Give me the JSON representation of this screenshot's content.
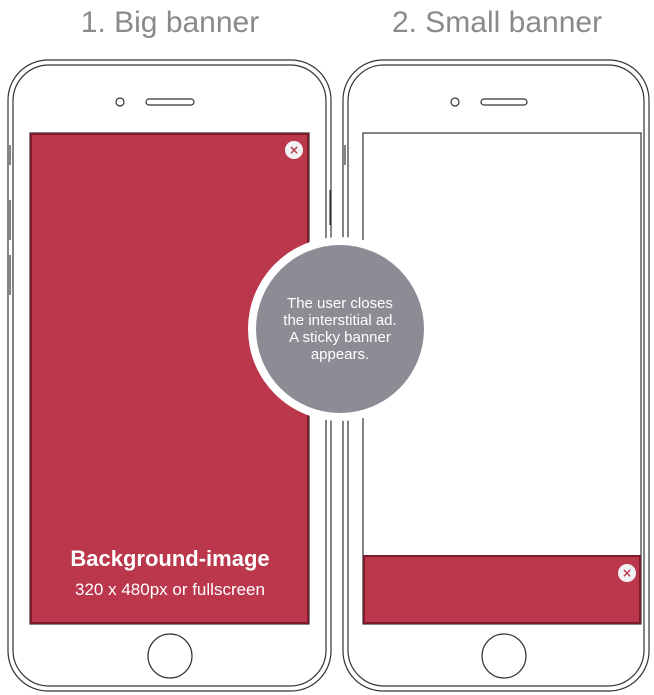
{
  "headings": {
    "step1": "1. Big banner",
    "step2": "2. Small banner"
  },
  "big_banner": {
    "title": "Background-image",
    "subtitle": "320 x 480px or fullscreen",
    "close_symbol": "×"
  },
  "small_banner": {
    "close_symbol": "×"
  },
  "transition_note": {
    "lines": [
      "The user closes",
      "the interstitial ad.",
      "A sticky banner",
      "appears."
    ]
  },
  "colors": {
    "banner": "#bb374c",
    "banner_border": "#7a1a2a",
    "phone_outline": "#333333",
    "bubble": "#7e8088",
    "heading": "#8a8a8a"
  },
  "icons": {
    "close": "close-icon",
    "camera": "camera-icon",
    "speaker": "speaker-icon",
    "home": "home-button-icon"
  }
}
